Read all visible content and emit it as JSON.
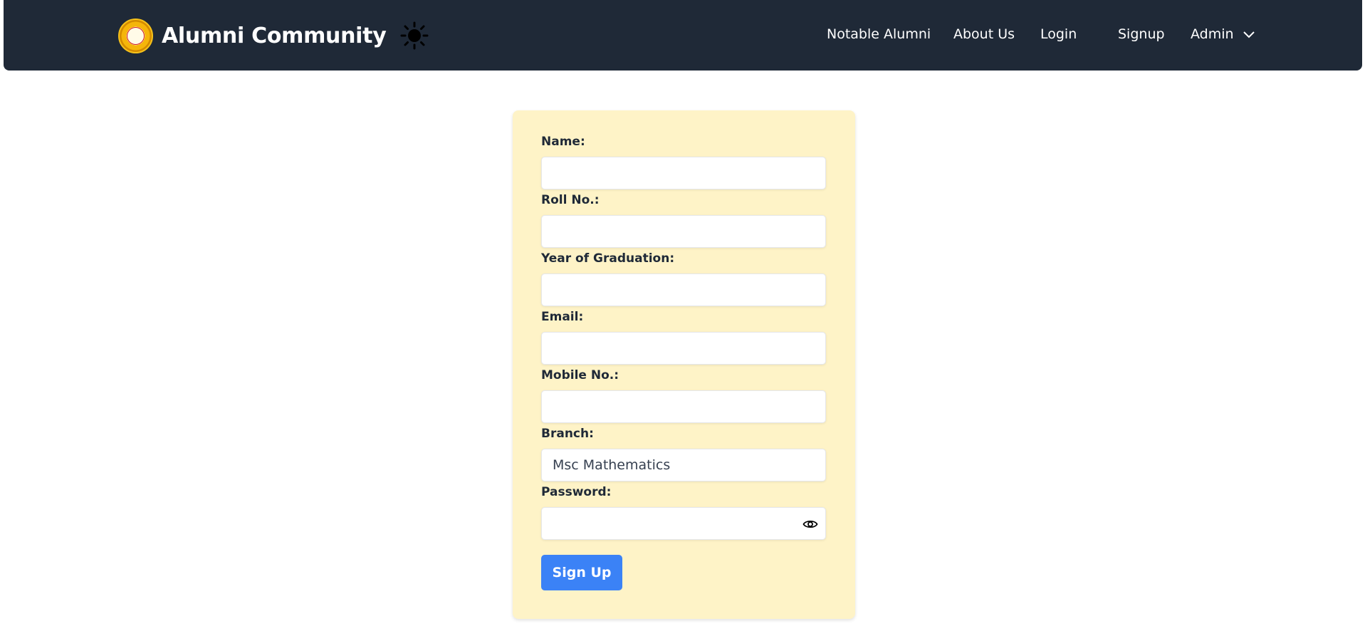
{
  "navbar": {
    "brand_title": "Alumni Community",
    "links": [
      "Notable Alumni",
      "About Us",
      "Login",
      "Signup",
      "Admin"
    ]
  },
  "form": {
    "fields": [
      {
        "label": "Name:",
        "value": ""
      },
      {
        "label": "Roll No.:",
        "value": ""
      },
      {
        "label": "Year of Graduation:",
        "value": ""
      },
      {
        "label": "Email:",
        "value": ""
      },
      {
        "label": "Mobile No.:",
        "value": ""
      },
      {
        "label": "Branch:",
        "value": "Msc Mathematics"
      },
      {
        "label": "Password:",
        "value": ""
      }
    ],
    "submit_label": "Sign Up"
  },
  "icons": {
    "logo": "college-logo-icon",
    "theme": "sun-icon",
    "dropdown": "chevron-down-icon",
    "password_toggle": "eye-icon"
  },
  "colors": {
    "navbar_bg": "#1f2937",
    "card_bg": "#fef3c7",
    "button_bg": "#3b82f6"
  }
}
